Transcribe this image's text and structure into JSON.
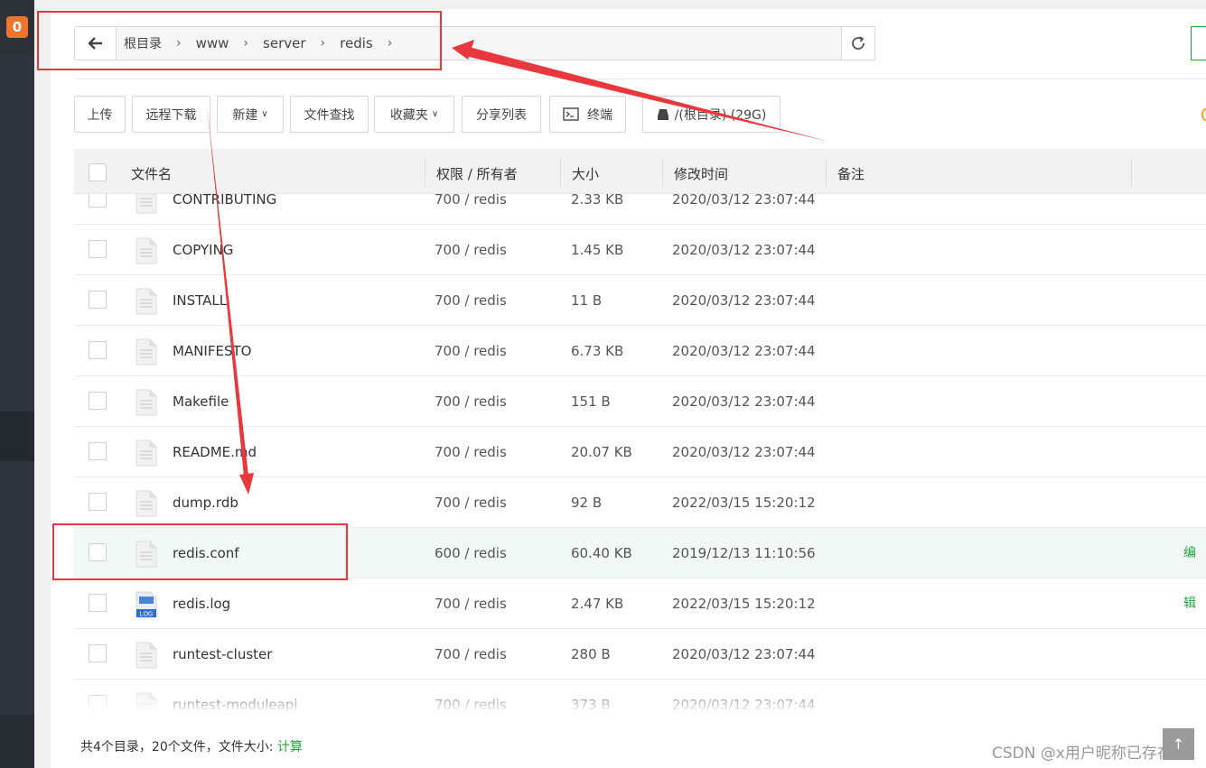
{
  "sidebar": {
    "badge": "0"
  },
  "breadcrumb": {
    "items": [
      "根目录",
      "www",
      "server",
      "redis"
    ]
  },
  "toolbar": {
    "upload": "上传",
    "remote_download": "远程下载",
    "new": "新建",
    "search": "文件查找",
    "favorites": "收藏夹",
    "share_list": "分享列表",
    "terminal": "终端",
    "disk": "/(根目录) (29G)"
  },
  "table": {
    "headers": {
      "name": "文件名",
      "perm": "权限 / 所有者",
      "size": "大小",
      "mtime": "修改时间",
      "note": "备注"
    },
    "rows": [
      {
        "name": "CONTRIBUTING",
        "perm": "700 / redis",
        "size": "2.33 KB",
        "time": "2020/03/12 23:07:44",
        "icon": "document-icon"
      },
      {
        "name": "COPYING",
        "perm": "700 / redis",
        "size": "1.45 KB",
        "time": "2020/03/12 23:07:44",
        "icon": "document-icon"
      },
      {
        "name": "INSTALL",
        "perm": "700 / redis",
        "size": "11 B",
        "time": "2020/03/12 23:07:44",
        "icon": "document-icon"
      },
      {
        "name": "MANIFESTO",
        "perm": "700 / redis",
        "size": "6.73 KB",
        "time": "2020/03/12 23:07:44",
        "icon": "document-icon"
      },
      {
        "name": "Makefile",
        "perm": "700 / redis",
        "size": "151 B",
        "time": "2020/03/12 23:07:44",
        "icon": "document-icon"
      },
      {
        "name": "README.md",
        "perm": "700 / redis",
        "size": "20.07 KB",
        "time": "2020/03/12 23:07:44",
        "icon": "document-icon"
      },
      {
        "name": "dump.rdb",
        "perm": "700 / redis",
        "size": "92 B",
        "time": "2022/03/15 15:20:12",
        "icon": "document-icon"
      },
      {
        "name": "redis.conf",
        "perm": "600 / redis",
        "size": "60.40 KB",
        "time": "2019/12/13 11:10:56",
        "icon": "document-icon",
        "action": "编辑"
      },
      {
        "name": "redis.log",
        "perm": "700 / redis",
        "size": "2.47 KB",
        "time": "2022/03/15 15:20:12",
        "icon": "log-file-icon",
        "icon_text": "LOG"
      },
      {
        "name": "runtest-cluster",
        "perm": "700 / redis",
        "size": "280 B",
        "time": "2020/03/12 23:07:44",
        "icon": "document-icon"
      },
      {
        "name": "runtest-moduleapi",
        "perm": "700 / redis",
        "size": "373 B",
        "time": "2020/03/12 23:07:44",
        "icon": "document-icon"
      }
    ]
  },
  "footer": {
    "summary": "共4个目录，20个文件，文件大小: ",
    "calc_link": "计算"
  },
  "watermark": "CSDN @x用户昵称已存在",
  "scroll_top": "↑",
  "colors": {
    "accent": "#20a53a",
    "annotation": "#e8383d",
    "badge": "#f0742a",
    "sidebar": "#2f353c"
  }
}
